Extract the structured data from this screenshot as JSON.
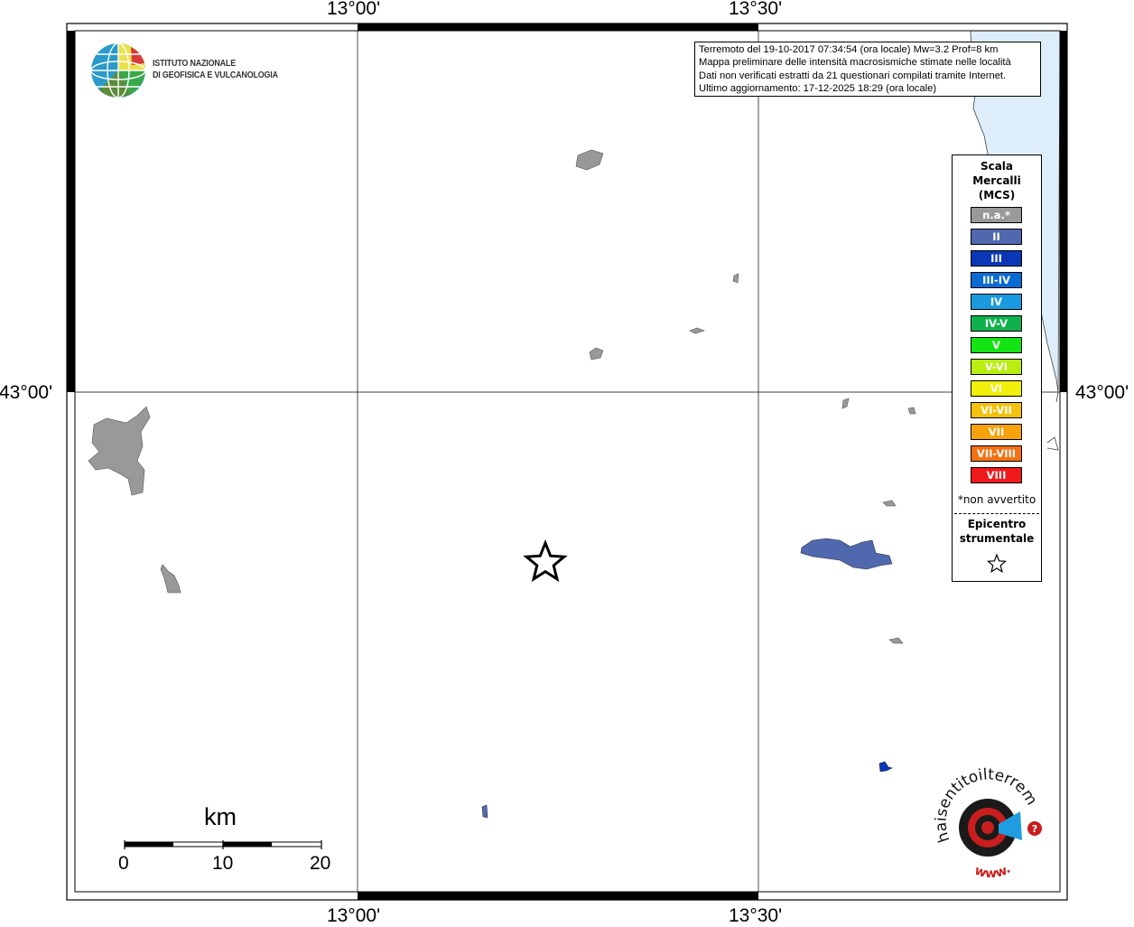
{
  "coordinates": {
    "top_left_lon": "13°00'",
    "top_right_lon": "13°30'",
    "bottom_left_lon": "13°00'",
    "bottom_right_lon": "13°30'",
    "left_lat": "43°00'",
    "right_lat": "43°00'"
  },
  "logo": {
    "line1": "ISTITUTO NAZIONALE",
    "line2": "DI GEOFISICA E VULCANOLOGIA"
  },
  "info": {
    "line1": "Terremoto del 19-10-2017 07:34:54 (ora locale) Mw=3.2 Prof=8 km",
    "line2": "Mappa preliminare delle intensità macrosismiche stimate nelle località",
    "line3": "Dati non verificati estratti da 21 questionari compilati tramite Internet.",
    "line4": "Ultimo aggiornamento: 17-12-2025 18:29 (ora locale)"
  },
  "legend": {
    "title1": "Scala",
    "title2": "Mercalli",
    "title3": "(MCS)",
    "items": [
      {
        "label": "n.a.*",
        "color": "#999999"
      },
      {
        "label": "II",
        "color": "#5068ae"
      },
      {
        "label": "III",
        "color": "#0a37b5"
      },
      {
        "label": "III-IV",
        "color": "#0a6ad4"
      },
      {
        "label": "IV",
        "color": "#1a9be0"
      },
      {
        "label": "IV-V",
        "color": "#10b14c"
      },
      {
        "label": "V",
        "color": "#14e414"
      },
      {
        "label": "V-VI",
        "color": "#b8ee10"
      },
      {
        "label": "VI",
        "color": "#f0f00a"
      },
      {
        "label": "VI-VII",
        "color": "#f4c20c"
      },
      {
        "label": "VII",
        "color": "#f7a20c"
      },
      {
        "label": "VII-VIII",
        "color": "#f47012"
      },
      {
        "label": "VIII",
        "color": "#f01a1a"
      }
    ],
    "note": "*non avvertito",
    "epicenter1": "Epicentro",
    "epicenter2": "strumentale"
  },
  "scalebar": {
    "unit": "km",
    "ticks": [
      "0",
      "10",
      "20"
    ]
  },
  "brand": {
    "text": "haisentitoilterremoto.it",
    "www": "www."
  },
  "colors": {
    "sea": "#ddeefa",
    "na": "#999999",
    "ii": "#5068ae",
    "iii": "#0a37b5"
  }
}
